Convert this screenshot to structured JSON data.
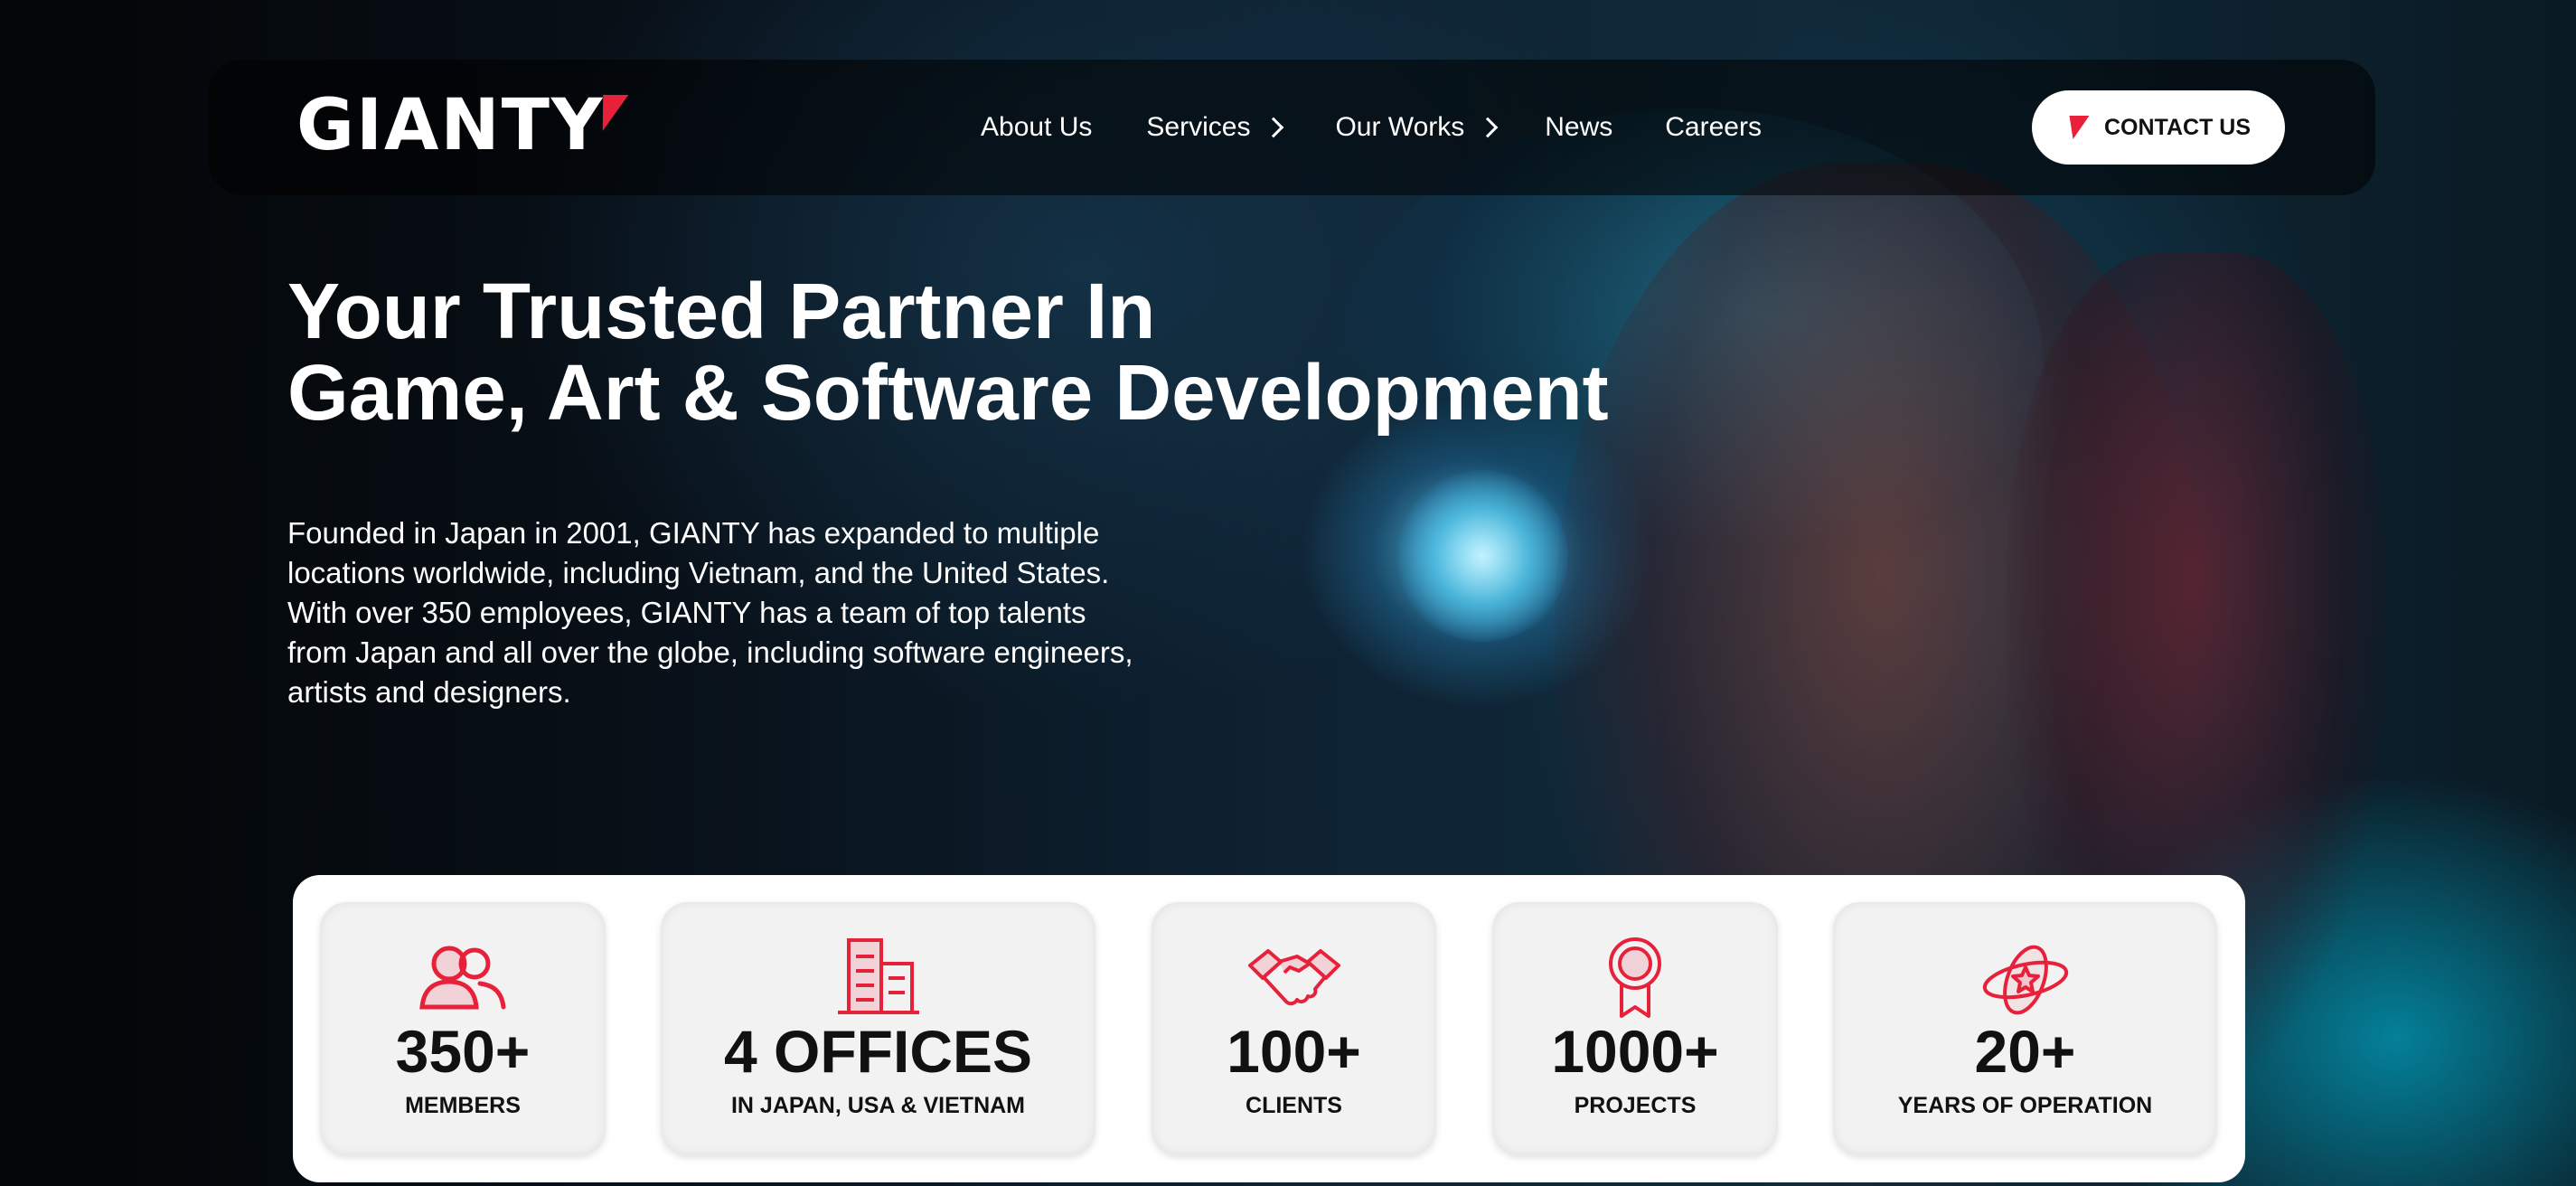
{
  "brand": {
    "logo_text": "GIANTY",
    "accent_color": "#e8213b"
  },
  "nav": {
    "items": [
      {
        "label": "About Us",
        "has_submenu": false
      },
      {
        "label": "Services",
        "has_submenu": true
      },
      {
        "label": "Our Works",
        "has_submenu": true
      },
      {
        "label": "News",
        "has_submenu": false
      },
      {
        "label": "Careers",
        "has_submenu": false
      }
    ],
    "contact_label": "CONTACT US"
  },
  "hero": {
    "headline_line1": "Your Trusted Partner In",
    "headline_line2": "Game, Art & Software Development",
    "intro_lines": [
      "Founded in Japan in 2001, GIANTY has expanded to multiple",
      "locations worldwide, including Vietnam, and the United States.",
      "With over 350 employees, GIANTY has a team of top talents",
      "from Japan and all over the globe, including software engineers,",
      "artists and designers."
    ]
  },
  "stats": [
    {
      "icon": "members-icon",
      "value": "350+",
      "label": "MEMBERS"
    },
    {
      "icon": "offices-icon",
      "value": "4 OFFICES",
      "label": "IN JAPAN, USA & VIETNAM"
    },
    {
      "icon": "handshake-icon",
      "value": "100+",
      "label": "CLIENTS"
    },
    {
      "icon": "award-icon",
      "value": "1000+",
      "label": "PROJECTS"
    },
    {
      "icon": "planet-star-icon",
      "value": "20+",
      "label": "YEARS OF OPERATION"
    }
  ]
}
